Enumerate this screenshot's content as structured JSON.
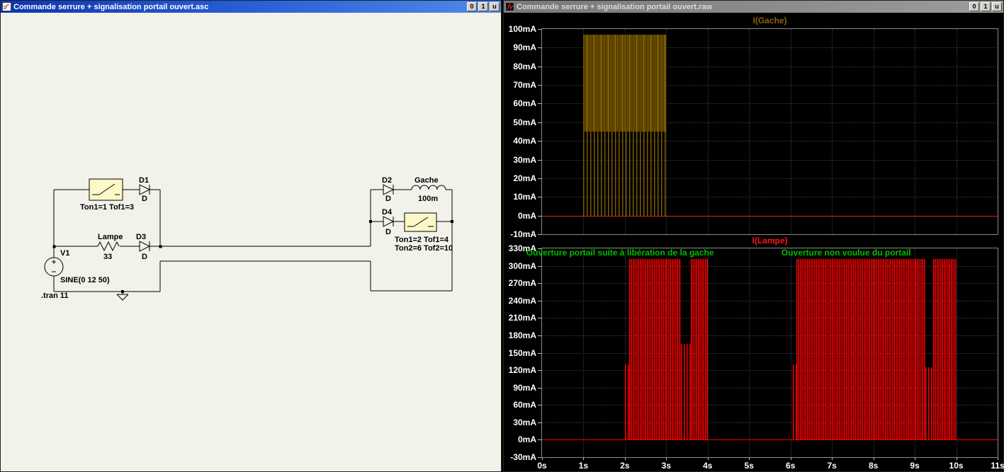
{
  "schematic_window": {
    "title": "Commande serrure + signalisation portail ouvert.asc",
    "controls": {
      "minimize": "0",
      "maximize": "1",
      "close": "u"
    },
    "labels": {
      "v1_name": "V1",
      "v1_value": "SINE(0 12 50)",
      "tran_directive": ".tran 11",
      "sw1_params": "Ton1=1 Tof1=3",
      "d1_name": "D1",
      "d1_model": "D",
      "lamp_name": "Lampe",
      "lamp_value": "33",
      "d3_name": "D3",
      "d3_model": "D",
      "d2_name": "D2",
      "d2_model": "D",
      "gache_name": "Gache",
      "gache_value": "100m",
      "d4_name": "D4",
      "d4_model": "D",
      "sw2_params_line1": "Ton1=2 Tof1=4",
      "sw2_params_line2": "Ton2=6 Tof2=10"
    }
  },
  "waveform_window": {
    "title": "Commande serrure + signalisation portail ouvert.raw",
    "controls": {
      "minimize": "0",
      "maximize": "1",
      "close": "u"
    }
  },
  "x_axis": {
    "labels": [
      "0s",
      "1s",
      "2s",
      "3s",
      "4s",
      "5s",
      "6s",
      "7s",
      "8s",
      "9s",
      "10s",
      "11s"
    ]
  },
  "chart_data": [
    {
      "type": "area",
      "title": "I(Gache)",
      "color": "#7d5c00",
      "title_color": "#8a6212",
      "baseline_color": "#c22d10",
      "ylim": [
        -10,
        100
      ],
      "ytick_step_mA": 10,
      "ytick_labels": [
        "100mA",
        "90mA",
        "80mA",
        "70mA",
        "60mA",
        "50mA",
        "40mA",
        "30mA",
        "20mA",
        "10mA",
        "0mA",
        "-10mA"
      ],
      "xlim": [
        0,
        11
      ],
      "grid": true,
      "bursts": [
        {
          "t0": 1.0,
          "t1": 3.0,
          "v0": 0,
          "v1": 97,
          "period": 5
        },
        {
          "t0": 1.0,
          "t1": 3.0,
          "v0": 45,
          "v1": 97,
          "period": 2
        }
      ],
      "annotations": []
    },
    {
      "type": "area",
      "title": "I(Lampe)",
      "color": "#ff0000",
      "title_color": "#ff1515",
      "baseline_color": "#ff0000",
      "ylim": [
        -30,
        330
      ],
      "ytick_step_mA": 30,
      "ytick_labels": [
        "330mA",
        "300mA",
        "270mA",
        "240mA",
        "210mA",
        "180mA",
        "150mA",
        "120mA",
        "90mA",
        "60mA",
        "30mA",
        "0mA",
        "-30mA"
      ],
      "xlim": [
        0,
        11
      ],
      "grid": true,
      "bursts": [
        {
          "t0": 2.0,
          "t1": 2.1,
          "v0": 0,
          "v1": 130,
          "period": 4
        },
        {
          "t0": 2.1,
          "t1": 3.35,
          "v0": 0,
          "v1": 312,
          "period": 2.5
        },
        {
          "t0": 3.35,
          "t1": 3.6,
          "v0": 0,
          "v1": 165,
          "period": 4
        },
        {
          "t0": 3.6,
          "t1": 4.0,
          "v0": 0,
          "v1": 312,
          "period": 2.5
        },
        {
          "t0": 6.05,
          "t1": 6.15,
          "v0": 0,
          "v1": 130,
          "period": 4
        },
        {
          "t0": 6.15,
          "t1": 9.25,
          "v0": 0,
          "v1": 312,
          "period": 2.5
        },
        {
          "t0": 9.25,
          "t1": 9.45,
          "v0": 0,
          "v1": 125,
          "period": 4
        },
        {
          "t0": 9.45,
          "t1": 10.0,
          "v0": 0,
          "v1": 312,
          "period": 2.5
        }
      ],
      "annotations": [
        {
          "text": "Ouverture portail suite à libération de la gache",
          "t": -0.38,
          "v": 318,
          "color": "#00c000"
        },
        {
          "text": "Ouverture non voulue du portail",
          "t": 5.78,
          "v": 318,
          "color": "#00c000"
        }
      ]
    }
  ]
}
